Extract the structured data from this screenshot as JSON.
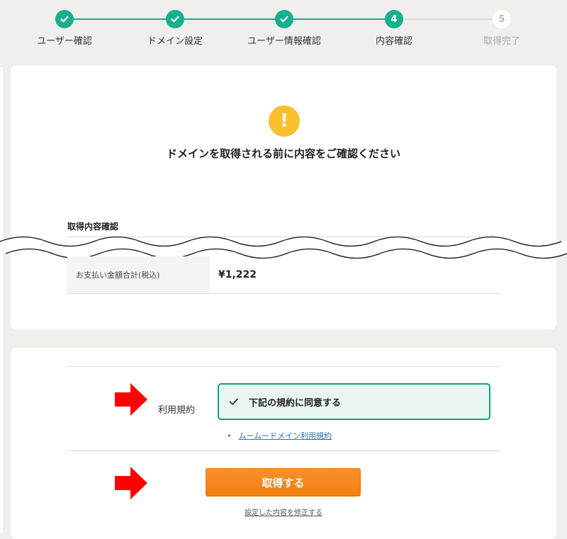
{
  "stepper": {
    "steps": [
      {
        "label": "ユーザー確認",
        "state": "done"
      },
      {
        "label": "ドメイン設定",
        "state": "done"
      },
      {
        "label": "ユーザー情報確認",
        "state": "done"
      },
      {
        "label": "内容確認",
        "state": "current",
        "number": "4"
      },
      {
        "label": "取得完了",
        "state": "pending",
        "number": "5"
      }
    ]
  },
  "confirm": {
    "alert_icon": "!",
    "headline": "ドメインを取得される前に内容をご確認ください",
    "section_title": "取得内容確認",
    "total_label": "お支払い金額合計(税込)",
    "total_value": "¥1,222"
  },
  "terms": {
    "label": "利用規約",
    "agree_text": "下記の規約に同意する",
    "agreed": true,
    "link_text": "ムームードメイン利用規約"
  },
  "actions": {
    "acquire_label": "取得する",
    "modify_label": "設定した内容を修正する"
  },
  "colors": {
    "accent": "#16b08d",
    "warning": "#fbc02d",
    "button": "#f5861b",
    "annotation_arrow": "#ff0000"
  }
}
